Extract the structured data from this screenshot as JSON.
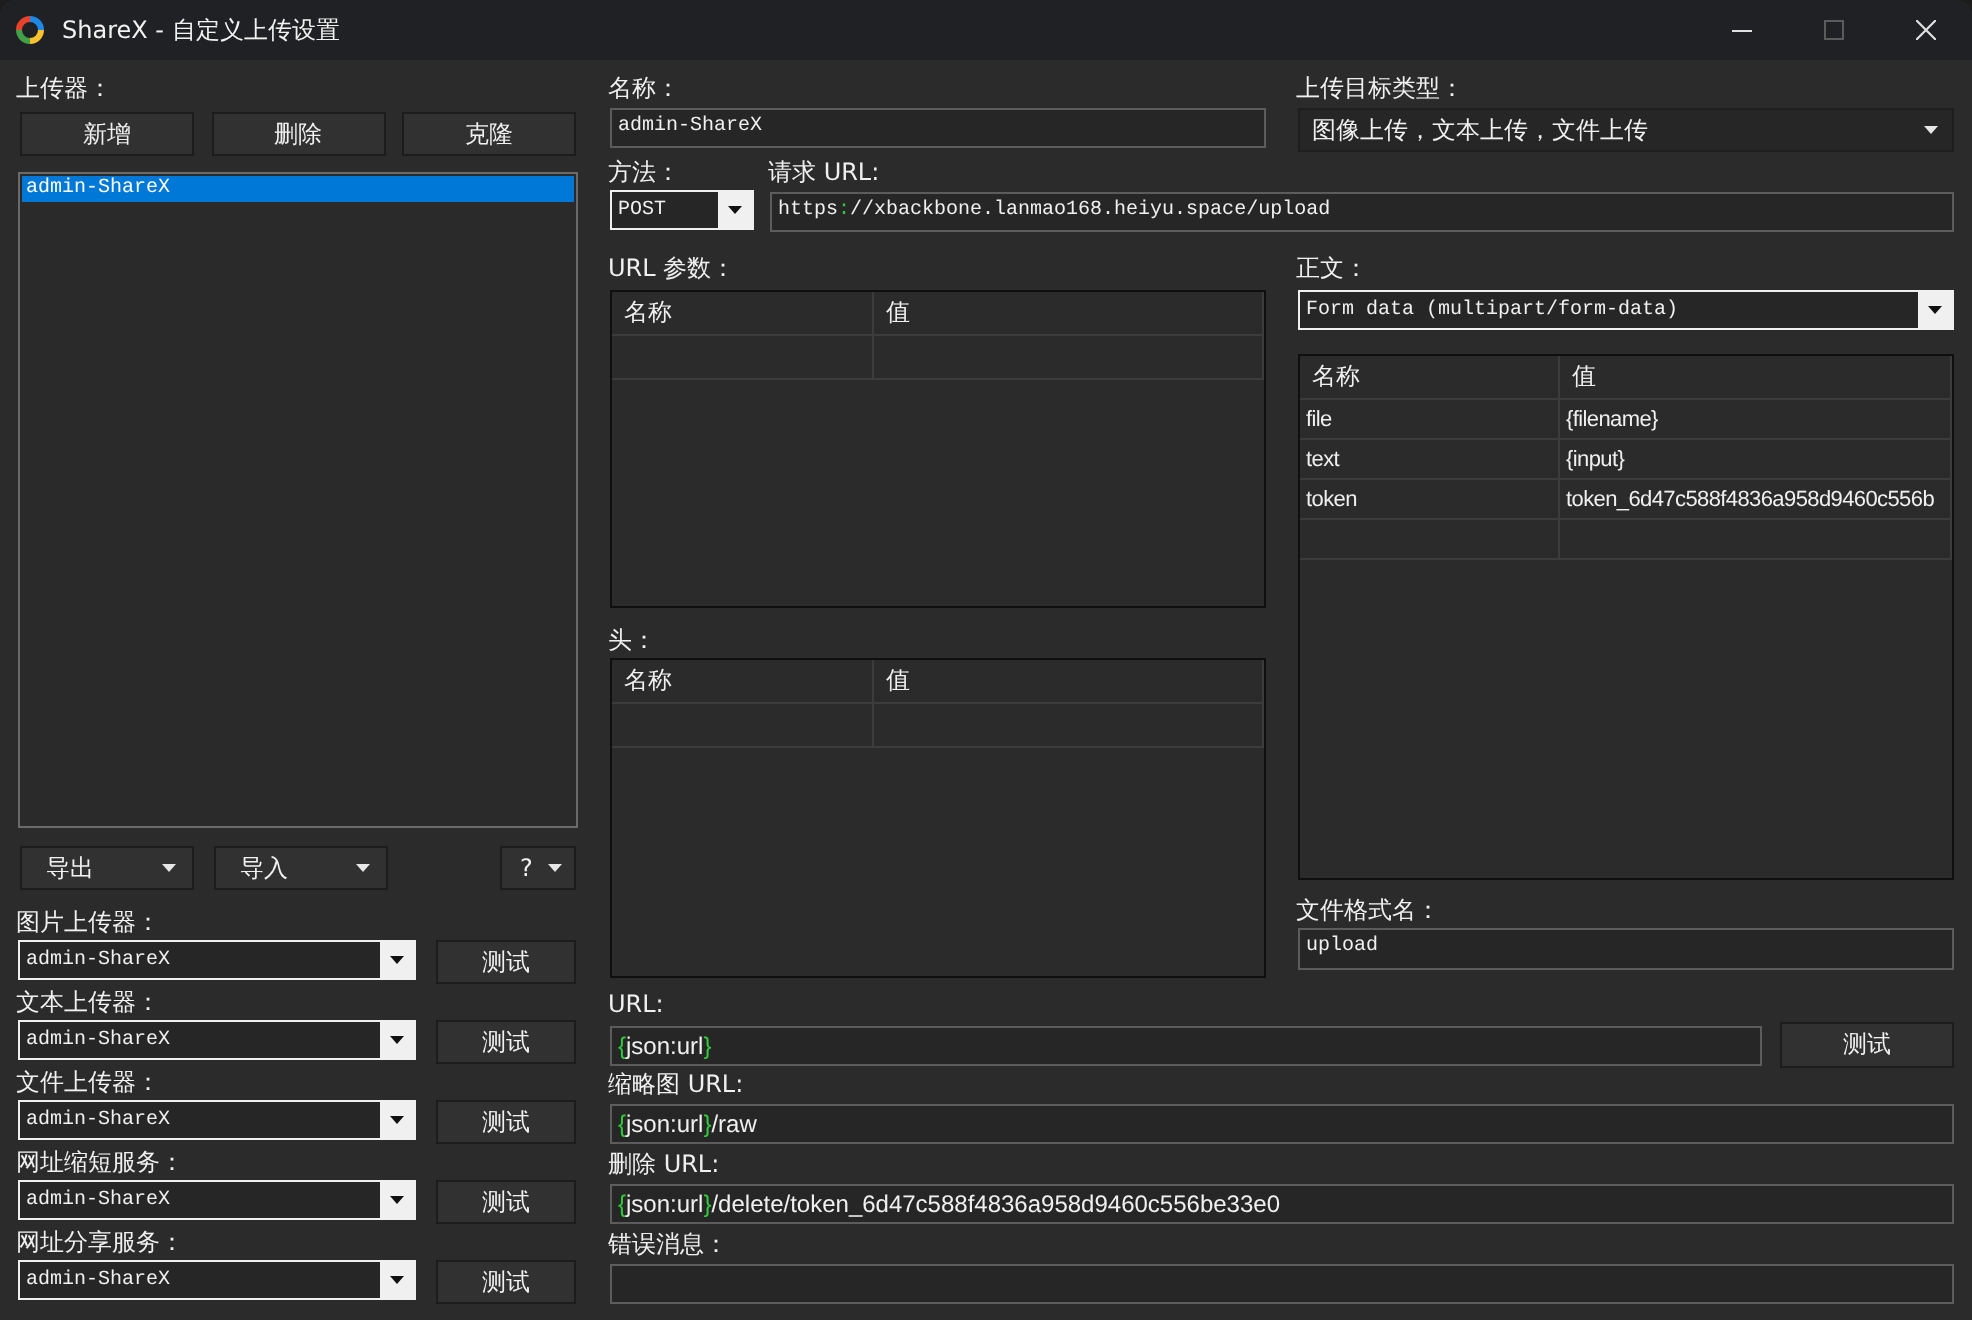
{
  "window": {
    "title": "ShareX - 自定义上传设置",
    "maximize_disabled": true
  },
  "uploaders": {
    "label": "上传器：",
    "buttons": [
      "新增",
      "删除",
      "克隆"
    ],
    "items": [
      {
        "name": "admin-ShareX",
        "selected": true
      }
    ],
    "menus": [
      "导出",
      "导入",
      "?"
    ]
  },
  "destinations": [
    {
      "label": "图片上传器：",
      "value": "admin-ShareX",
      "button": "测试"
    },
    {
      "label": "文本上传器：",
      "value": "admin-ShareX",
      "button": "测试"
    },
    {
      "label": "文件上传器：",
      "value": "admin-ShareX",
      "button": "测试"
    },
    {
      "label": "网址缩短服务：",
      "value": "admin-ShareX",
      "button": "测试"
    },
    {
      "label": "网址分享服务：",
      "value": "admin-ShareX",
      "button": "测试"
    }
  ],
  "request": {
    "name_label": "名称：",
    "name": "admin-ShareX",
    "method_label": "方法：",
    "method": "POST",
    "url_label": "请求 URL:",
    "url": "https://xbackbone.lanmao168.heiyu.space/upload"
  },
  "destination_type": {
    "label": "上传目标类型：",
    "value": "图像上传，文本上传，文件上传"
  },
  "url_parameters": {
    "label": "URL 参数：",
    "columns": [
      "名称",
      "值"
    ]
  },
  "headers": {
    "label": "头：",
    "columns": [
      "名称",
      "值"
    ]
  },
  "body": {
    "label": "正文：",
    "value": "Form data (multipart/form-data)",
    "columns": [
      "名称",
      "值"
    ],
    "rows": [
      {
        "name": "file",
        "value": "{filename}"
      },
      {
        "name": "text",
        "value": "{input}"
      },
      {
        "name": "token",
        "value": "token_6d47c588f4836a958d9460c556b"
      }
    ],
    "file_form_name_label": "文件格式名：",
    "file_form_name": "upload"
  },
  "response": [
    {
      "label": "URL:",
      "value": "{json:url}",
      "button": "测试"
    },
    {
      "label": "缩略图 URL:",
      "value": "{json:url}/raw"
    },
    {
      "label": "删除 URL:",
      "value": "{json:url}/delete/token_6d47c588f4836a958d9460c556be33e0"
    },
    {
      "label": "错误消息："
    }
  ]
}
